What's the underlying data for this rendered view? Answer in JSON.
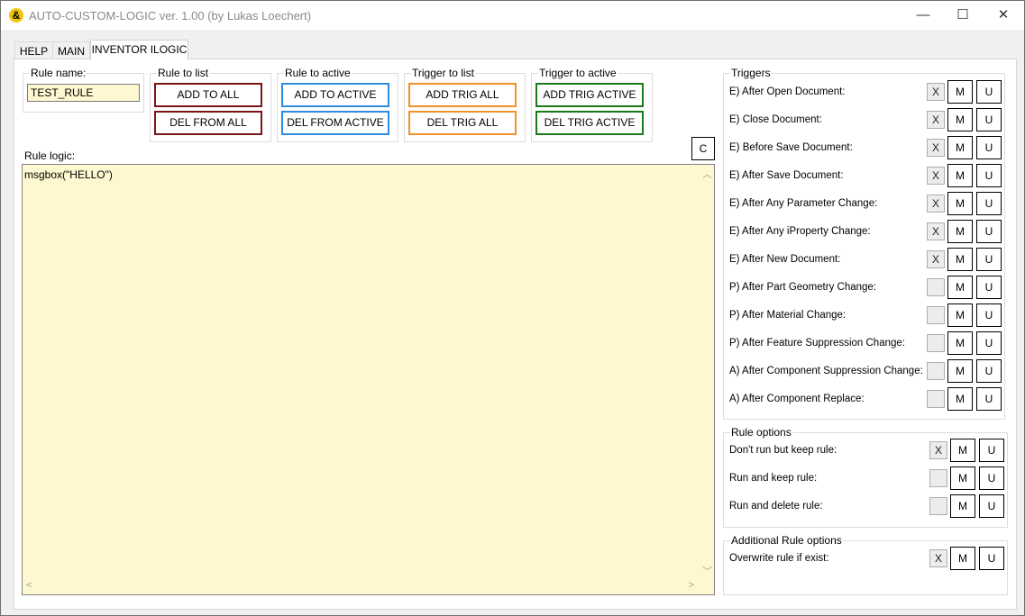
{
  "window": {
    "title": "AUTO-CUSTOM-LOGIC ver. 1.00 (by Lukas Loechert)",
    "minimize": "—",
    "maximize": "☐",
    "close": "✕"
  },
  "tabs": [
    {
      "label": "HELP"
    },
    {
      "label": "MAIN"
    },
    {
      "label": "INVENTOR ILOGIC"
    }
  ],
  "rule_name": {
    "label": "Rule name:",
    "value": "TEST_RULE"
  },
  "groups": [
    {
      "label": "Rule to list",
      "buttons": [
        "ADD TO ALL",
        "DEL FROM ALL"
      ],
      "color": "#7b1414"
    },
    {
      "label": "Rule to active",
      "buttons": [
        "ADD TO ACTIVE",
        "DEL FROM ACTIVE"
      ],
      "color": "#2d8be0"
    },
    {
      "label": "Trigger to list",
      "buttons": [
        "ADD TRIG ALL",
        "DEL TRIG ALL"
      ],
      "color": "#f0922a"
    },
    {
      "label": "Trigger to active",
      "buttons": [
        "ADD TRIG ACTIVE",
        "DEL TRIG ACTIVE"
      ],
      "color": "#1a7a1a"
    }
  ],
  "clear_button": "C",
  "rule_logic": {
    "label": "Rule logic:",
    "code": "msgbox(\"HELLO\")"
  },
  "triggers": {
    "label": "Triggers",
    "rows": [
      {
        "label": "E) After Open Document:",
        "check": "X"
      },
      {
        "label": "E) Close Document:",
        "check": "X"
      },
      {
        "label": "E) Before Save Document:",
        "check": "X"
      },
      {
        "label": "E) After Save Document:",
        "check": "X"
      },
      {
        "label": "E) After Any Parameter Change:",
        "check": "X"
      },
      {
        "label": "E) After Any iProperty Change:",
        "check": "X"
      },
      {
        "label": "E) After New Document:",
        "check": "X"
      },
      {
        "label": "P) After Part Geometry Change:",
        "check": ""
      },
      {
        "label": "P) After Material Change:",
        "check": ""
      },
      {
        "label": "P) After Feature Suppression Change:",
        "check": ""
      },
      {
        "label": "A) After Component Suppression Change:",
        "check": ""
      },
      {
        "label": "A) After Component Replace:",
        "check": ""
      }
    ]
  },
  "rule_options": {
    "label": "Rule options",
    "rows": [
      {
        "label": "Don't run but keep rule:",
        "check": "X"
      },
      {
        "label": "Run and keep rule:",
        "check": ""
      },
      {
        "label": "Run and delete rule:",
        "check": ""
      }
    ]
  },
  "additional_options": {
    "label": "Additional Rule options",
    "rows": [
      {
        "label": "Overwrite rule if exist:",
        "check": "X"
      }
    ]
  },
  "row_buttons": {
    "m": "M",
    "u": "U"
  }
}
